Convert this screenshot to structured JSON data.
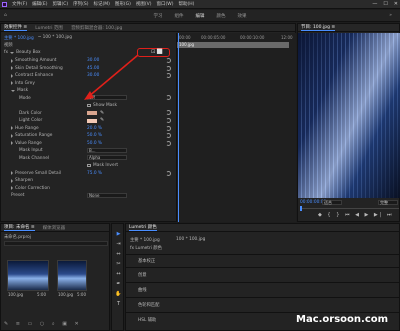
{
  "menubar": {
    "items": [
      "文件(F)",
      "编辑(E)",
      "剪辑(C)",
      "序列(S)",
      "标记(M)",
      "图形(G)",
      "视图(V)",
      "窗口(W)",
      "帮助(H)"
    ]
  },
  "window_controls": [
    "—",
    "☐",
    "✕"
  ],
  "workspace": {
    "tabs": [
      "学习",
      "组件",
      "编辑",
      "颜色",
      "效果"
    ],
    "active": "编辑"
  },
  "effect_controls": {
    "tabs": [
      "效果控件 ≡",
      "Lumetri 范围",
      "音频剪辑混合器: 100.jpg"
    ],
    "source_label": "主要 * 100.jpg",
    "clip_label": "~ 100 * 100.jpg",
    "section_label": "视频",
    "effect_name": "Beauty Box",
    "fx_badge": "fx",
    "params": [
      {
        "label": "Smoothing Amount",
        "value": "30.00"
      },
      {
        "label": "Skin Detail Smoothing",
        "value": "45.00"
      },
      {
        "label": "Contrast Enhance",
        "value": "30.00"
      },
      {
        "label": "Into Grey",
        "value": ""
      },
      {
        "label": "Mask",
        "value": ""
      },
      {
        "label": "Mode",
        "value": "Off"
      },
      {
        "label": "Show Mask",
        "value": ""
      },
      {
        "label": "Dark Color",
        "value": ""
      },
      {
        "label": "Light Color",
        "value": ""
      },
      {
        "label": "Hue Range",
        "value": "20.0 %"
      },
      {
        "label": "Saturation Range",
        "value": "50.0 %"
      },
      {
        "label": "Value Range",
        "value": "50.0 %"
      },
      {
        "label": "Mask Input",
        "value": "B..."
      },
      {
        "label": "Mask Channel",
        "value": "Alpha"
      },
      {
        "label": "Mask Invert",
        "value": ""
      },
      {
        "label": "Preserve Small Detail",
        "value": "75.0 %"
      },
      {
        "label": "Sharpen",
        "value": ""
      },
      {
        "label": "Color Correction",
        "value": ""
      },
      {
        "label": "Preset",
        "value": "None"
      }
    ]
  },
  "timeline_mini": {
    "times": [
      "00:00",
      "00:00:05:00",
      "00:00:10:00",
      "12:00"
    ],
    "clip": "100.jpg"
  },
  "program": {
    "title": "节目: 100.jpg ≡",
    "fit": "适合",
    "zoom": "完整",
    "timecode": "00:00:00:00"
  },
  "project": {
    "tabs": [
      "项目: 未命名 ≡",
      "媒体浏览器"
    ],
    "path": "未命名.prproj",
    "items": [
      {
        "name": "100.jpg",
        "duration": "5:00"
      },
      {
        "name": "100.jpg",
        "duration": "5:00"
      }
    ]
  },
  "lumetri": {
    "title": "Lumetri 颜色",
    "source": "主要 * 100.jpg",
    "clip": "100 * 100.jpg",
    "fx": "fx Lumetri 颜色",
    "sections": [
      "基本校正",
      "创意",
      "曲线",
      "色轮和匹配",
      "HSL 辅助"
    ]
  },
  "watermark": "Mac.orsoon.com",
  "colors": {
    "accent": "#4a8eff",
    "annotation": "#e0201a",
    "panel": "#232323"
  }
}
